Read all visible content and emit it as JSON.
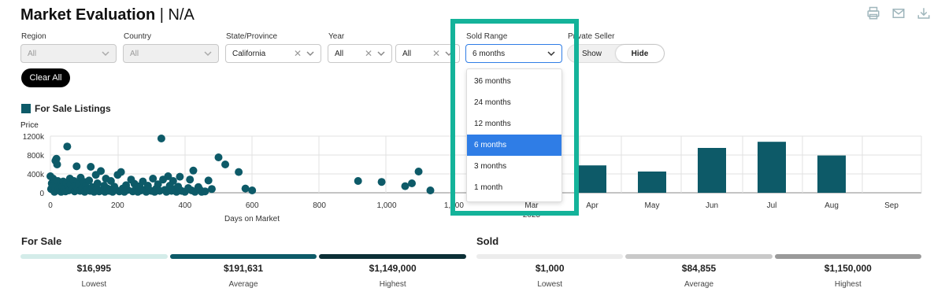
{
  "header": {
    "title": "Market Evaluation",
    "separator": "|",
    "subtitle": "N/A",
    "icons": [
      "print-icon",
      "mail-icon",
      "download-icon"
    ]
  },
  "filters": {
    "region": {
      "label": "Region",
      "value": "All"
    },
    "country": {
      "label": "Country",
      "value": "All"
    },
    "state": {
      "label": "State/Province",
      "value": "California"
    },
    "year": {
      "label": "Year",
      "value1": "All",
      "value2": "All"
    },
    "sold_range": {
      "label": "Sold Range",
      "value": "6 months",
      "options": [
        "36 months",
        "24 months",
        "12 months",
        "6 months",
        "3 months",
        "1 month"
      ],
      "selected": "6 months"
    },
    "private_seller": {
      "label": "Private Seller",
      "options": [
        "Show",
        "Hide"
      ],
      "selected": "Hide"
    },
    "clear_all": "Clear All"
  },
  "colors": {
    "teal": "#0d5a68",
    "accent": "#14b39a",
    "selected": "#2f7de6"
  },
  "chart_data": [
    {
      "type": "scatter",
      "title": "For Sale Listings",
      "ylabel": "Price",
      "xlabel": "Days on Market",
      "y_ticks": [
        "0",
        "400k",
        "800k",
        "1200k"
      ],
      "x_ticks": [
        "0",
        "200",
        "400",
        "600",
        "800",
        "1,000",
        "1,200"
      ],
      "xlim": [
        0,
        1300
      ],
      "ylim": [
        0,
        1200000
      ],
      "points": [
        [
          0,
          350000
        ],
        [
          2,
          80000
        ],
        [
          4,
          200000
        ],
        [
          6,
          150000
        ],
        [
          8,
          300000
        ],
        [
          10,
          60000
        ],
        [
          12,
          20000
        ],
        [
          14,
          110000
        ],
        [
          15,
          680000
        ],
        [
          18,
          720000
        ],
        [
          20,
          600000
        ],
        [
          22,
          250000
        ],
        [
          25,
          90000
        ],
        [
          28,
          40000
        ],
        [
          30,
          160000
        ],
        [
          32,
          20000
        ],
        [
          35,
          130000
        ],
        [
          38,
          240000
        ],
        [
          40,
          60000
        ],
        [
          45,
          30000
        ],
        [
          48,
          210000
        ],
        [
          50,
          980000
        ],
        [
          52,
          120000
        ],
        [
          55,
          50000
        ],
        [
          58,
          300000
        ],
        [
          60,
          170000
        ],
        [
          65,
          80000
        ],
        [
          70,
          250000
        ],
        [
          72,
          30000
        ],
        [
          75,
          150000
        ],
        [
          78,
          560000
        ],
        [
          80,
          60000
        ],
        [
          85,
          190000
        ],
        [
          88,
          40000
        ],
        [
          90,
          320000
        ],
        [
          95,
          100000
        ],
        [
          100,
          230000
        ],
        [
          102,
          20000
        ],
        [
          105,
          140000
        ],
        [
          110,
          70000
        ],
        [
          115,
          260000
        ],
        [
          118,
          40000
        ],
        [
          120,
          550000
        ],
        [
          125,
          120000
        ],
        [
          130,
          20000
        ],
        [
          135,
          380000
        ],
        [
          138,
          90000
        ],
        [
          140,
          200000
        ],
        [
          145,
          30000
        ],
        [
          150,
          460000
        ],
        [
          155,
          60000
        ],
        [
          160,
          150000
        ],
        [
          162,
          20000
        ],
        [
          165,
          300000
        ],
        [
          170,
          90000
        ],
        [
          175,
          40000
        ],
        [
          180,
          250000
        ],
        [
          185,
          20000
        ],
        [
          190,
          130000
        ],
        [
          195,
          60000
        ],
        [
          200,
          380000
        ],
        [
          205,
          30000
        ],
        [
          210,
          440000
        ],
        [
          215,
          90000
        ],
        [
          220,
          20000
        ],
        [
          225,
          160000
        ],
        [
          230,
          60000
        ],
        [
          240,
          280000
        ],
        [
          245,
          30000
        ],
        [
          250,
          190000
        ],
        [
          255,
          80000
        ],
        [
          260,
          20000
        ],
        [
          265,
          140000
        ],
        [
          270,
          50000
        ],
        [
          275,
          240000
        ],
        [
          280,
          60000
        ],
        [
          285,
          20000
        ],
        [
          290,
          150000
        ],
        [
          300,
          40000
        ],
        [
          305,
          300000
        ],
        [
          310,
          20000
        ],
        [
          315,
          90000
        ],
        [
          320,
          180000
        ],
        [
          325,
          40000
        ],
        [
          330,
          1150000
        ],
        [
          335,
          280000
        ],
        [
          340,
          60000
        ],
        [
          345,
          20000
        ],
        [
          350,
          350000
        ],
        [
          355,
          150000
        ],
        [
          360,
          40000
        ],
        [
          365,
          250000
        ],
        [
          370,
          80000
        ],
        [
          375,
          20000
        ],
        [
          380,
          130000
        ],
        [
          385,
          340000
        ],
        [
          390,
          40000
        ],
        [
          400,
          20000
        ],
        [
          410,
          100000
        ],
        [
          415,
          280000
        ],
        [
          420,
          50000
        ],
        [
          425,
          470000
        ],
        [
          430,
          20000
        ],
        [
          440,
          120000
        ],
        [
          445,
          60000
        ],
        [
          450,
          20000
        ],
        [
          460,
          30000
        ],
        [
          470,
          260000
        ],
        [
          480,
          80000
        ],
        [
          500,
          750000
        ],
        [
          520,
          600000
        ],
        [
          560,
          440000
        ],
        [
          580,
          90000
        ],
        [
          600,
          50000
        ],
        [
          915,
          250000
        ],
        [
          985,
          230000
        ],
        [
          1055,
          140000
        ],
        [
          1075,
          200000
        ],
        [
          1095,
          450000
        ],
        [
          1130,
          50000
        ]
      ]
    },
    {
      "type": "bar",
      "categories": [
        "Mar 2025",
        "Apr",
        "May",
        "Jun",
        "Jul",
        "Aug",
        "Sep"
      ],
      "values": [
        0,
        580000,
        450000,
        950000,
        1080000,
        790000,
        0
      ],
      "ylim": [
        0,
        1200000
      ]
    }
  ],
  "summary": {
    "for_sale": {
      "title": "For Sale",
      "stats": [
        {
          "value": "$16,995",
          "label": "Lowest",
          "color": "#d4ece9"
        },
        {
          "value": "$191,631",
          "label": "Average",
          "color": "#0d5a68"
        },
        {
          "value": "$1,149,000",
          "label": "Highest",
          "color": "#0b2f36"
        }
      ]
    },
    "sold": {
      "title": "Sold",
      "stats": [
        {
          "value": "$1,000",
          "label": "Lowest",
          "color": "#ececec"
        },
        {
          "value": "$84,855",
          "label": "Average",
          "color": "#c9c9c9"
        },
        {
          "value": "$1,150,000",
          "label": "Highest",
          "color": "#9a9a9a"
        }
      ]
    }
  }
}
